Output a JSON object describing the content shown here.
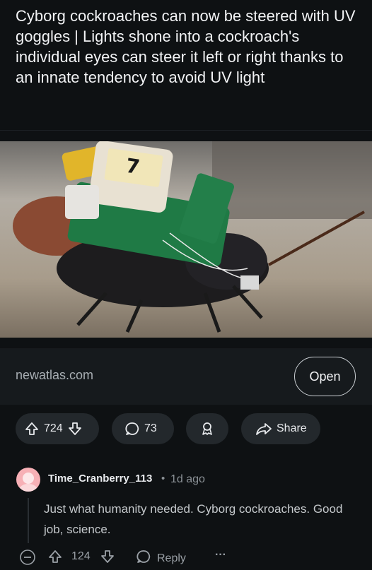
{
  "post": {
    "title": "Cyborg cockroaches can now be steered with UV goggles | Lights shone into a cockroach's individual eyes can steer it left or right thanks to an innate tendency to avoid UV light",
    "image_label": "7",
    "link": {
      "domain": "newatlas.com",
      "open_label": "Open"
    },
    "actions": {
      "upvotes": "724",
      "comments": "73",
      "share_label": "Share"
    }
  },
  "comment": {
    "username": "Time_Cranberry_113",
    "separator": "•",
    "time": "1d ago",
    "body": "Just what humanity needed. Cyborg cockroaches. Good job, science.",
    "upvotes": "124",
    "reply_label": "Reply",
    "more_label": "···"
  },
  "colors": {
    "background": "#0e1113",
    "pill": "#23282c",
    "avatar": "#f7b0b6"
  },
  "icons": [
    "upvote-icon",
    "downvote-icon",
    "comment-icon",
    "award-icon",
    "share-icon",
    "collapse-icon",
    "reply-icon",
    "more-icon"
  ]
}
